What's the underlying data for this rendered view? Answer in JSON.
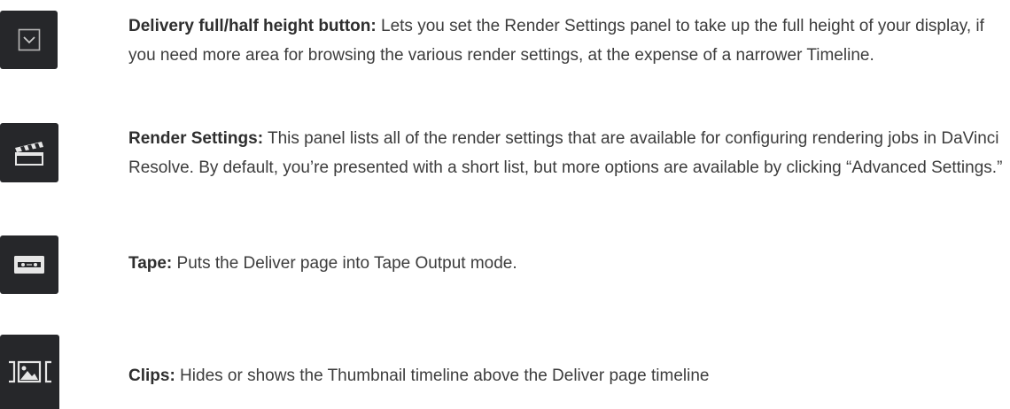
{
  "entries": [
    {
      "icon": "chevron-down-icon",
      "term": "Delivery full/half height button:",
      "text": " Lets you set the Render Settings panel to take up the full height of your display, if you need more area for browsing the various render settings, at the expense of a narrower Timeline."
    },
    {
      "icon": "clapperboard-icon",
      "term": "Render Settings:",
      "text": " This panel lists all of the render settings that are available for configuring rendering jobs in DaVinci Resolve. By default, you’re presented with a short list, but more options are available by clicking “Advanced Settings.”"
    },
    {
      "icon": "tape-icon",
      "term": "Tape:",
      "text": " Puts the Deliver page into Tape Output mode."
    },
    {
      "icon": "clips-thumbnail-icon",
      "term": "Clips:",
      "text": " Hides or shows the Thumbnail timeline above the Deliver page timeline"
    }
  ],
  "colors": {
    "icon_background": "#26272a",
    "icon_foreground": "#c8c8c8",
    "text": "#3c3c3c"
  }
}
